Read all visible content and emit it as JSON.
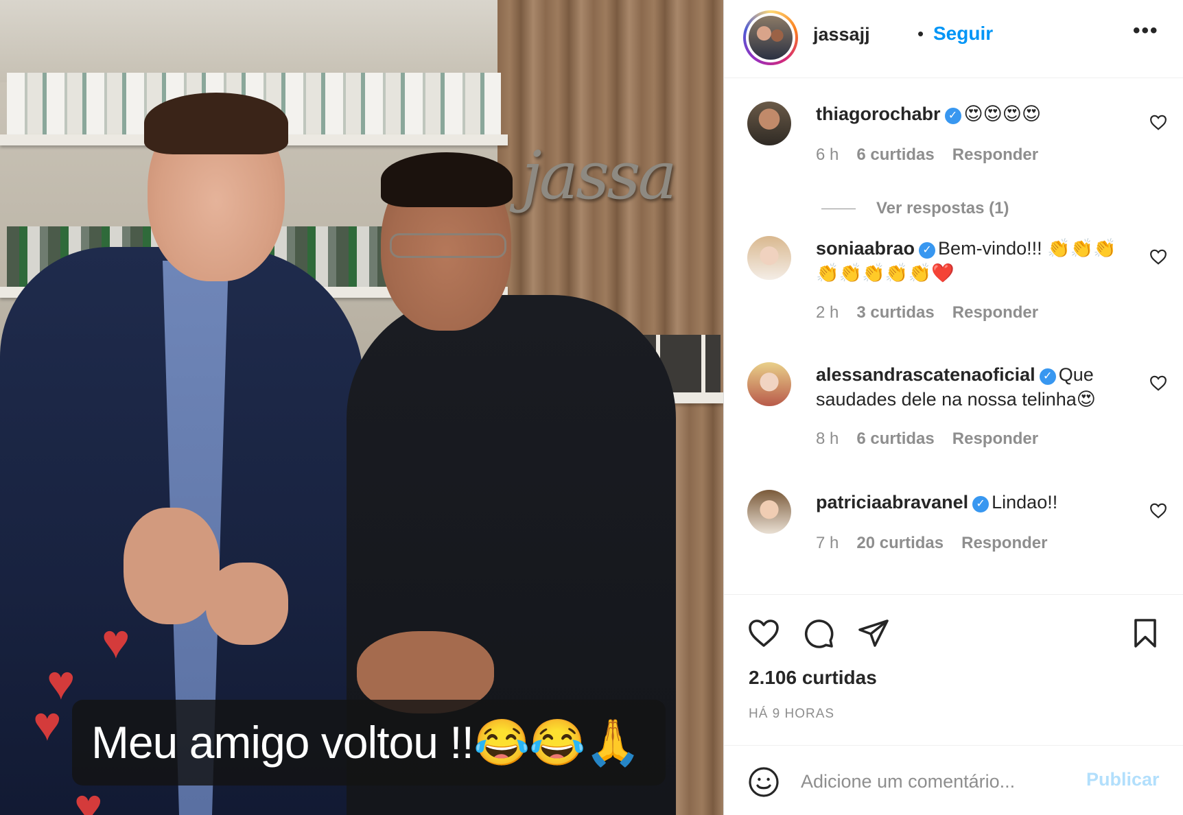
{
  "post": {
    "caption_overlay": "Meu amigo voltou !!😂😂🙏",
    "sign_text": "jassa"
  },
  "header": {
    "username": "jassajj",
    "separator": "•",
    "follow_label": "Seguir",
    "more_label": "•••",
    "more_icon": "more-horizontal-icon"
  },
  "comments": [
    {
      "username": "thiagorochabr",
      "verified": true,
      "text": "😍😍😍😍",
      "time": "6 h",
      "likes": "6 curtidas",
      "reply_label": "Responder",
      "view_replies": "Ver respostas (1)"
    },
    {
      "username": "soniaabrao",
      "verified": true,
      "text": "Bem-vindo!!! 👏👏👏👏👏👏👏👏❤️",
      "time": "2 h",
      "likes": "3 curtidas",
      "reply_label": "Responder"
    },
    {
      "username": "alessandrascatenaoficial",
      "verified": true,
      "text": "Que saudades dele na nossa telinha😍",
      "time": "8 h",
      "likes": "6 curtidas",
      "reply_label": "Responder"
    },
    {
      "username": "patriciaabravanel",
      "verified": true,
      "text": "Lindao!!",
      "time": "7 h",
      "likes": "20 curtidas",
      "reply_label": "Responder"
    }
  ],
  "actions": {
    "like_icon": "heart-icon",
    "comment_icon": "comment-icon",
    "share_icon": "send-icon",
    "save_icon": "bookmark-icon",
    "likes_count": "2.106 curtidas",
    "time_ago": "HÁ 9 HORAS"
  },
  "add_comment": {
    "emoji_icon": "emoji-icon",
    "placeholder": "Adicione um comentário...",
    "publish_label": "Publicar"
  },
  "colors": {
    "accent": "#0095f6",
    "publish_disabled": "#b2dffc",
    "muted": "#8e8e8e",
    "verified": "#3897f0",
    "text": "#262626"
  }
}
